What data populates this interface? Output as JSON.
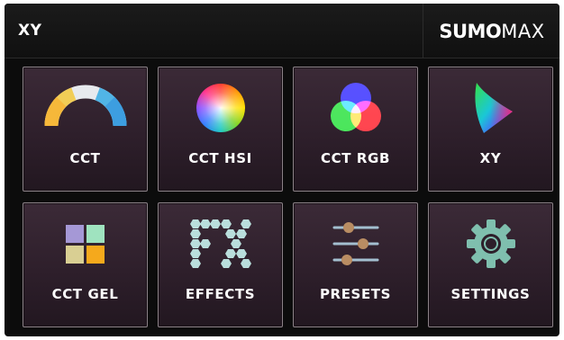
{
  "topbar": {
    "title": "XY",
    "brand_bold": "SUMO",
    "brand_light": "MAX"
  },
  "tiles": [
    {
      "label": "CCT",
      "icon": "cct-arc-icon"
    },
    {
      "label": "CCT HSI",
      "icon": "color-wheel-icon"
    },
    {
      "label": "CCT RGB",
      "icon": "rgb-circles-icon"
    },
    {
      "label": "XY",
      "icon": "color-gamut-triangle-icon"
    },
    {
      "label": "CCT GEL",
      "icon": "gel-swatches-icon"
    },
    {
      "label": "EFFECTS",
      "icon": "fx-hexagons-icon"
    },
    {
      "label": "PRESETS",
      "icon": "sliders-icon"
    },
    {
      "label": "SETTINGS",
      "icon": "gear-icon"
    }
  ],
  "colors": {
    "background": "#0c0c0c",
    "tile_top": "#3b2a37",
    "tile_bottom": "#221720",
    "tile_border": "#8c8288",
    "gel_purple": "#a598d6",
    "gel_green": "#9fe3bf",
    "gel_tan": "#d9cf93",
    "gel_orange": "#f5a91c",
    "fx_hex": "#b9dedc",
    "gear": "#7fbfae",
    "preset_knob": "#b98d63",
    "preset_line": "#a3bfd0"
  }
}
